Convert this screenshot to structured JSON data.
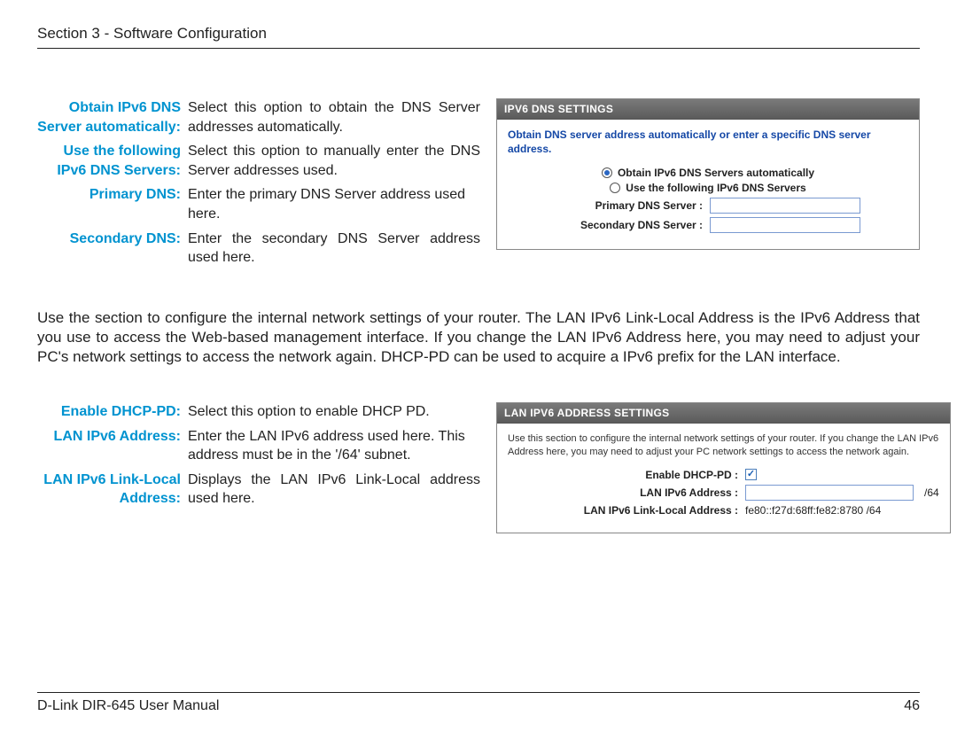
{
  "header": {
    "section": "Section 3 - Software Configuration"
  },
  "defs1": [
    {
      "label": "Obtain IPv6 DNS Server automatically:",
      "value": "Select this option to obtain the DNS Server addresses automatically."
    },
    {
      "label": "Use the following IPv6 DNS Servers:",
      "value": "Select this option to manually enter the DNS Server addresses used."
    },
    {
      "label": "Primary DNS:",
      "value": "Enter the primary DNS Server address used here."
    },
    {
      "label": "Secondary DNS:",
      "value": "Enter the secondary DNS Server address used here."
    }
  ],
  "panel1": {
    "title": "IPV6 DNS SETTINGS",
    "note": "Obtain DNS server address automatically or enter a specific DNS server address.",
    "radio1": "Obtain IPv6 DNS Servers automatically",
    "radio2": "Use the following IPv6 DNS Servers",
    "primary_label": "Primary DNS Server  :",
    "secondary_label": "Secondary DNS Server  :"
  },
  "paragraph": "Use the section to configure the internal network settings of your router. The LAN IPv6 Link-Local Address is the IPv6 Address that you use to access the Web-based management interface. If you change the LAN IPv6 Address here, you may need to adjust your PC's network settings to access the network again. DHCP-PD can be used to acquire a IPv6 prefix for the LAN interface.",
  "defs2": [
    {
      "label": "Enable DHCP-PD:",
      "value": "Select this option to enable DHCP PD."
    },
    {
      "label": "LAN IPv6 Address:",
      "value": "Enter the LAN IPv6 address used here. This address must be in the '/64' subnet."
    },
    {
      "label": "LAN IPv6 Link-Local Address:",
      "value": "Displays the LAN IPv6 Link-Local address used here."
    }
  ],
  "panel2": {
    "title": "LAN IPV6 ADDRESS SETTINGS",
    "desc": "Use this section to configure the internal network settings of your router. If you change the LAN IPv6 Address here, you may need to adjust your PC network settings to access the network again.",
    "enable_label": "Enable DHCP-PD  :",
    "addr_label": "LAN IPv6 Address  :",
    "addr_suffix": "/64",
    "linklocal_label": "LAN IPv6 Link-Local Address  :",
    "linklocal_value": "fe80::f27d:68ff:fe82:8780 /64"
  },
  "footer": {
    "left": "D-Link DIR-645 User Manual",
    "right": "46"
  }
}
